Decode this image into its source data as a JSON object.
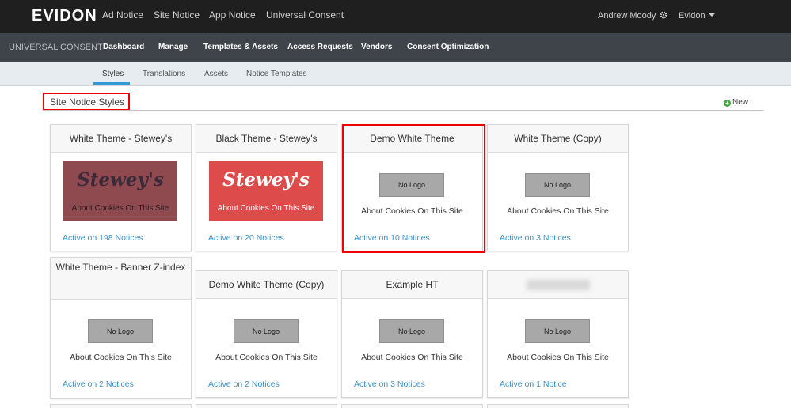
{
  "topbar": {
    "logo": "EVIDON",
    "nav": [
      "Ad Notice",
      "Site Notice",
      "App Notice",
      "Universal Consent"
    ],
    "user": "Andrew Moody",
    "org": "Evidon"
  },
  "subbar": {
    "label": "UNIVERSAL CONSENT",
    "nav": [
      "Dashboard",
      "Manage",
      "Templates & Assets",
      "Access Requests",
      "Vendors",
      "Consent Optimization"
    ]
  },
  "tabs": [
    "Styles",
    "Translations",
    "Assets",
    "Notice Templates"
  ],
  "active_tab": "Styles",
  "section": {
    "title": "Site Notice Styles",
    "new_label": "New"
  },
  "cards": [
    {
      "title": "White Theme - Stewey's",
      "preview": "Stewey's",
      "about": "About Cookies On This Site",
      "active": "Active on 198 Notices"
    },
    {
      "title": "Black Theme - Stewey's",
      "preview": "Stewey's",
      "about": "About Cookies On This Site",
      "active": "Active on 20 Notices"
    },
    {
      "title": "Demo White Theme",
      "logo": "No Logo",
      "about": "About Cookies On This Site",
      "active": "Active on 10 Notices"
    },
    {
      "title": "White Theme (Copy)",
      "logo": "No Logo",
      "about": "About Cookies On This Site",
      "active": "Active on 3 Notices"
    },
    {
      "title": "White Theme - Banner Z-index",
      "logo": "No Logo",
      "about": "About Cookies On This Site",
      "active": "Active on 2 Notices"
    },
    {
      "title": "Demo White Theme (Copy)",
      "logo": "No Logo",
      "about": "About Cookies On This Site",
      "active": "Active on 2 Notices"
    },
    {
      "title": "Example HT",
      "logo": "No Logo",
      "about": "About Cookies On This Site",
      "active": "Active on 3 Notices"
    },
    {
      "title": "",
      "logo": "No Logo",
      "about": "About Cookies On This Site",
      "active": "Active on 1 Notice"
    }
  ],
  "colors": {
    "topbar": "#1f1f1f",
    "subbar": "#3e4449",
    "tabbar": "#e6ecef",
    "link": "#3a8fc9",
    "highlight": "#e00000",
    "preview_white_theme_bg": "#8e4a4f",
    "preview_white_theme_script": "#3b2a3a",
    "preview_black_theme_bg": "#de4b4b"
  },
  "icons": {
    "settings": "gear-icon",
    "dropdown": "caret-down-icon",
    "new": "plus-circle-icon"
  }
}
